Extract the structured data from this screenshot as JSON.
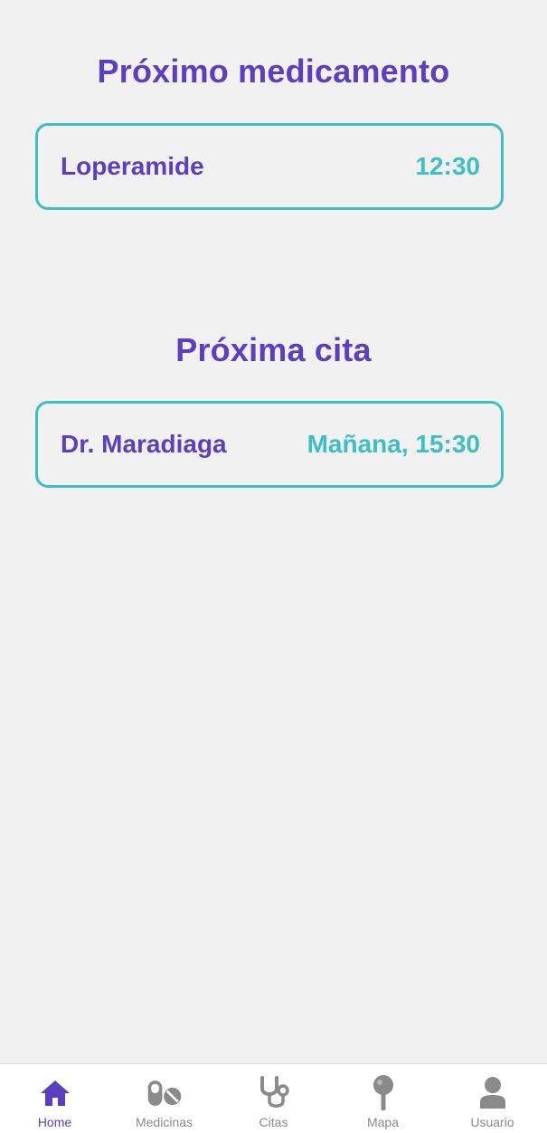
{
  "next_medication": {
    "title": "Próximo medicamento",
    "name": "Loperamide",
    "time": "12:30"
  },
  "next_appointment": {
    "title": "Próxima cita",
    "doctor": "Dr. Maradiaga",
    "when": "Mañana, 15:30"
  },
  "colors": {
    "primary": "#5a40c0",
    "accent": "#3fbfc4",
    "background": "#f1f1f1",
    "inactive": "#8a8a8a"
  },
  "nav": {
    "items": [
      {
        "label": "Home",
        "icon": "home-icon",
        "active": true
      },
      {
        "label": "Medicinas",
        "icon": "pills-icon",
        "active": false
      },
      {
        "label": "Citas",
        "icon": "stethoscope-icon",
        "active": false
      },
      {
        "label": "Mapa",
        "icon": "map-pin-icon",
        "active": false
      },
      {
        "label": "Usuario",
        "icon": "user-icon",
        "active": false
      }
    ]
  }
}
